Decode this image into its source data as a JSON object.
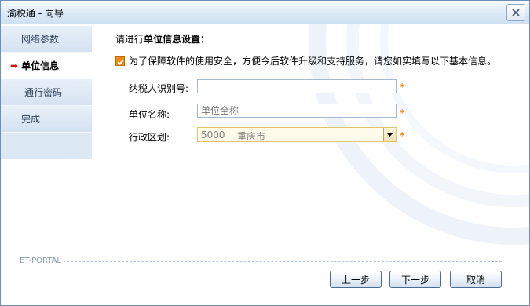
{
  "window": {
    "title": "渝税通 - 向导"
  },
  "sidebar": {
    "items": [
      {
        "label": "网络参数"
      },
      {
        "label": "单位信息",
        "active": true,
        "marker": "➡"
      },
      {
        "label": "通行密码"
      },
      {
        "label": "完成"
      }
    ]
  },
  "main": {
    "heading_prefix": "请进行",
    "heading_bold": "单位信息设置：",
    "note": "为了保障软件的使用安全，方便今后软件升级和支持服务，请您如实填写以下基本信息。",
    "note_icon": "checkbox-note-icon",
    "fields": {
      "tax_id": {
        "label": "纳税人识别号:",
        "value": "",
        "required": "*"
      },
      "unit_name": {
        "label": "单位名称:",
        "value": "",
        "placeholder": "单位全称",
        "required": "*"
      },
      "region": {
        "label": "行政区划:",
        "code": "5000",
        "name": "重庆市",
        "required": "*"
      }
    }
  },
  "footer": {
    "brand": "ET-PORTAL",
    "buttons": {
      "prev": "上一步",
      "next": "下一步",
      "cancel": "取消"
    }
  },
  "colors": {
    "accent": "#f08a18",
    "sidebar_bg": "#dde8f5",
    "border": "#6b8fb8",
    "marker": "#d01010"
  }
}
